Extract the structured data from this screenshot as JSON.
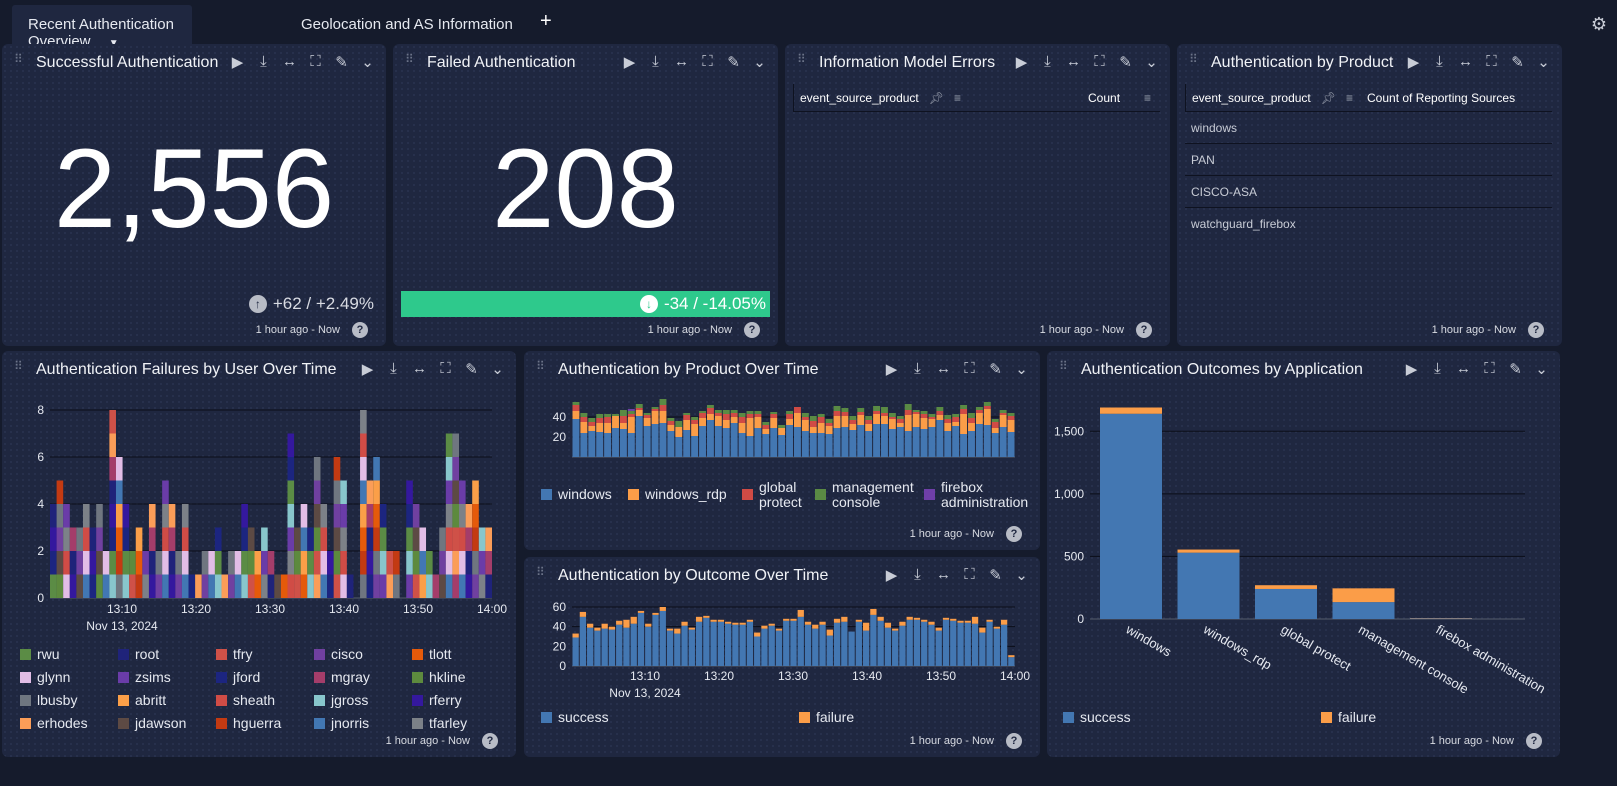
{
  "tabs": [
    {
      "label": "Recent Authentication Overview",
      "active": true
    },
    {
      "label": "Geolocation and AS Information",
      "active": false
    }
  ],
  "add_tab": "+",
  "settings_icon": "gear-icon",
  "time_range": "1 hour ago - Now",
  "help": "?",
  "panels": {
    "success": {
      "title": "Successful Authentication",
      "value": "2,556",
      "delta": "+62 / +2.49%",
      "trend": "up"
    },
    "failed": {
      "title": "Failed Authentication",
      "value": "208",
      "delta": "-34 / -14.05%",
      "trend": "down",
      "delta_bar_color": "#2ec98c"
    },
    "model_errors": {
      "title": "Information Model Errors",
      "columns": [
        "event_source_product",
        "Count"
      ],
      "rows": []
    },
    "by_product": {
      "title": "Authentication by Product",
      "columns": [
        "event_source_product",
        "Count of Reporting Sources"
      ],
      "rows": [
        "windows",
        "PAN",
        "CISCO-ASA",
        "watchguard_firebox"
      ]
    },
    "failures_user": {
      "title": "Authentication Failures by User Over Time"
    },
    "product_time": {
      "title": "Authentication by Product Over Time"
    },
    "outcome_time": {
      "title": "Authentication by Outcome Over Time"
    },
    "outcome_app": {
      "title": "Authentication Outcomes by Application"
    }
  },
  "chart_data": [
    {
      "id": "failures_user",
      "type": "bar",
      "stacked": true,
      "ylim": [
        0,
        8
      ],
      "yticks": [
        "0",
        "2",
        "4",
        "6",
        "8"
      ],
      "xticks": [
        "13:10",
        "13:20",
        "13:30",
        "13:40",
        "13:50",
        "14:00"
      ],
      "xsub": "Nov 13, 2024",
      "legend": [
        {
          "name": "rwu",
          "color": "#5b8c45"
        },
        {
          "name": "root",
          "color": "#1f237a"
        },
        {
          "name": "tfry",
          "color": "#cf5148"
        },
        {
          "name": "cisco",
          "color": "#7040a0"
        },
        {
          "name": "tlott",
          "color": "#e55a0a"
        },
        {
          "name": "glynn",
          "color": "#e2bde6"
        },
        {
          "name": "zsims",
          "color": "#6a3ca8"
        },
        {
          "name": "jford",
          "color": "#1c2580"
        },
        {
          "name": "mgray",
          "color": "#a43d6a"
        },
        {
          "name": "hkline",
          "color": "#5d8a3e"
        },
        {
          "name": "lbusby",
          "color": "#6f7680"
        },
        {
          "name": "abritt",
          "color": "#fb9f48"
        },
        {
          "name": "sheath",
          "color": "#d04c46"
        },
        {
          "name": "jgross",
          "color": "#88c6cc"
        },
        {
          "name": "rferry",
          "color": "#34189e"
        },
        {
          "name": "erhodes",
          "color": "#fb9d58"
        },
        {
          "name": "jdawson",
          "color": "#5d4a44"
        },
        {
          "name": "hguerra",
          "color": "#c33a12"
        },
        {
          "name": "jnorris",
          "color": "#4277b3"
        },
        {
          "name": "tfarley",
          "color": "#7c8188"
        }
      ],
      "totals": [
        4,
        5,
        4,
        3,
        3,
        4,
        3,
        4,
        2,
        8,
        6,
        4,
        2,
        3,
        2,
        4,
        2,
        5,
        4,
        2,
        4,
        1,
        1,
        2,
        2,
        3,
        1,
        2,
        2,
        4,
        3,
        2,
        3,
        2,
        1,
        1,
        7,
        3,
        4,
        3,
        6,
        4,
        2,
        6,
        5,
        1,
        0,
        8,
        5,
        6,
        4,
        2,
        2,
        0,
        5,
        4,
        3,
        2,
        1,
        3,
        7,
        7,
        5,
        4,
        5,
        3,
        3
      ]
    },
    {
      "id": "product_time",
      "type": "bar",
      "stacked": true,
      "yticks": [
        "20",
        "40"
      ],
      "ylim": [
        0,
        60
      ],
      "legend": [
        {
          "name": "windows",
          "color": "#4377b2"
        },
        {
          "name": "windows_rdp",
          "color": "#fb9d48"
        },
        {
          "name": "global protect",
          "color": "#d04b45"
        },
        {
          "name": "management console",
          "color": "#5a8a44"
        },
        {
          "name": "firebox administration",
          "color": "#6f3fa8"
        }
      ],
      "series": {
        "windows": [
          38,
          24,
          26,
          25,
          24,
          29,
          28,
          24,
          41,
          31,
          33,
          34,
          26,
          20,
          27,
          21,
          31,
          37,
          31,
          29,
          34,
          24,
          21,
          29,
          23,
          29,
          22,
          32,
          30,
          26,
          24,
          24,
          23,
          29,
          30,
          27,
          32,
          26,
          33,
          33,
          28,
          30,
          26,
          30,
          28,
          30,
          37,
          26,
          31,
          23,
          26,
          33,
          32,
          24,
          30,
          25
        ],
        "windows_rdp": [
          8,
          11,
          5,
          9,
          10,
          12,
          6,
          16,
          6,
          8,
          13,
          12,
          6,
          10,
          10,
          12,
          8,
          6,
          10,
          8,
          6,
          10,
          18,
          11,
          5,
          10,
          7,
          6,
          14,
          11,
          6,
          10,
          8,
          12,
          11,
          6,
          10,
          7,
          10,
          8,
          10,
          4,
          16,
          13,
          11,
          8,
          5,
          8,
          4,
          20,
          8,
          11,
          16,
          5,
          12,
          12
        ],
        "windows_extra": [],
        "global protect": [
          6,
          5,
          4,
          5,
          6,
          0,
          7,
          3,
          2,
          3,
          2,
          6,
          4,
          0,
          5,
          4,
          5,
          6,
          3,
          6,
          4,
          6,
          4,
          3,
          4,
          4,
          0,
          5,
          6,
          3,
          6,
          6,
          3,
          5,
          4,
          4,
          3,
          4,
          3,
          3,
          2,
          4,
          5,
          2,
          4,
          2,
          4,
          4,
          5,
          5,
          5,
          3,
          3,
          6,
          2,
          4
        ],
        "management console": [
          3,
          4,
          4,
          4,
          3,
          2,
          6,
          3,
          4,
          2,
          2,
          6,
          3,
          6,
          2,
          3,
          2,
          3,
          3,
          4,
          3,
          4,
          3,
          3,
          3,
          2,
          3,
          3,
          0,
          4,
          5,
          3,
          4,
          5,
          4,
          4,
          4,
          4,
          5,
          6,
          4,
          3,
          6,
          2,
          3,
          3,
          4,
          4,
          3,
          4,
          5,
          3,
          4,
          3,
          3,
          3
        ],
        "firebox administration": [
          0,
          0,
          0,
          0,
          0,
          0,
          0,
          2,
          0,
          0,
          0,
          0,
          0,
          0,
          0,
          0,
          0,
          0,
          0,
          0,
          0,
          0,
          0,
          0,
          0,
          0,
          0,
          0,
          0,
          0,
          0,
          0,
          0,
          0,
          0,
          0,
          0,
          0,
          0,
          0,
          0,
          0,
          0,
          0,
          0,
          0,
          0,
          0,
          0,
          0,
          0,
          0,
          0,
          0,
          0,
          0
        ]
      }
    },
    {
      "id": "outcome_time",
      "type": "bar",
      "stacked": true,
      "ylim": [
        0,
        60
      ],
      "yticks": [
        "0",
        "20",
        "40",
        "60"
      ],
      "xticks": [
        "13:10",
        "13:20",
        "13:30",
        "13:40",
        "13:50",
        "14:00"
      ],
      "xsub": "Nov 13, 2024",
      "legend": [
        {
          "name": "success",
          "color": "#4377b2"
        },
        {
          "name": "failure",
          "color": "#fb9d48"
        }
      ],
      "series": {
        "success": [
          29,
          50,
          39,
          36,
          38,
          37,
          42,
          39,
          43,
          54,
          40,
          52,
          56,
          36,
          33,
          41,
          37,
          45,
          49,
          45,
          45,
          43,
          42,
          42,
          45,
          30,
          38,
          41,
          36,
          46,
          46,
          50,
          42,
          38,
          42,
          31,
          44,
          45,
          35,
          45,
          36,
          52,
          46,
          39,
          36,
          41,
          47,
          47,
          45,
          42,
          36,
          47,
          46,
          44,
          44,
          43,
          34,
          45,
          38,
          42,
          9
        ],
        "failure": [
          4,
          5,
          4,
          3,
          5,
          3,
          4,
          8,
          7,
          2,
          3,
          2,
          4,
          2,
          5,
          4,
          2,
          5,
          2,
          2,
          2,
          2,
          2,
          2,
          2,
          4,
          3,
          2,
          2,
          2,
          2,
          7,
          3,
          4,
          3,
          6,
          4,
          5,
          0,
          2,
          8,
          6,
          4,
          5,
          2,
          4,
          3,
          2,
          2,
          3,
          3,
          2,
          2,
          2,
          2,
          7,
          5,
          2,
          2,
          5,
          2
        ]
      }
    },
    {
      "id": "outcome_app",
      "type": "bar",
      "stacked": true,
      "ylim": [
        0,
        1750
      ],
      "yticks": [
        "0",
        "500",
        "1,000",
        "1,500"
      ],
      "categories": [
        "windows",
        "windows_rdp",
        "global protect",
        "management console",
        "firebox administration"
      ],
      "legend": [
        {
          "name": "success",
          "color": "#4377b2"
        },
        {
          "name": "failure",
          "color": "#fb9d48"
        }
      ],
      "series": [
        {
          "name": "success",
          "values": [
            1640,
            530,
            240,
            135,
            5
          ]
        },
        {
          "name": "failure",
          "values": [
            50,
            25,
            30,
            110,
            3
          ]
        }
      ]
    }
  ]
}
